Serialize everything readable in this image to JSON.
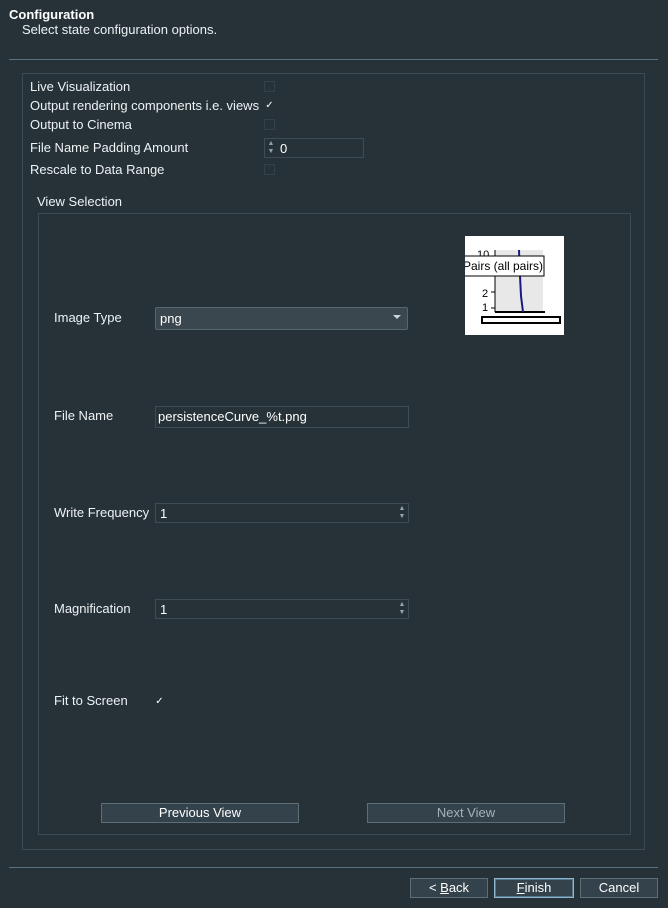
{
  "header": {
    "title": "Configuration",
    "subtitle": "Select state configuration options."
  },
  "options": {
    "live_visualization": {
      "label": "Live Visualization",
      "checked": false
    },
    "output_rendering": {
      "label": "Output rendering components i.e. views",
      "checked": true
    },
    "output_cinema": {
      "label": "Output to Cinema",
      "checked": false
    },
    "padding": {
      "label": "File Name Padding Amount",
      "value": "0"
    },
    "rescale": {
      "label": "Rescale to Data Range",
      "checked": false
    }
  },
  "view_selection": {
    "title": "View Selection",
    "image_type": {
      "label": "Image Type",
      "value": "png"
    },
    "file_name": {
      "label": "File Name",
      "value": "persistenceCurve_%t.png"
    },
    "write_frequency": {
      "label": "Write Frequency",
      "value": "1"
    },
    "magnification": {
      "label": "Magnification",
      "value": "1"
    },
    "fit_to_screen": {
      "label": "Fit to Screen",
      "checked": true
    },
    "previous_view": "Previous View",
    "next_view": "Next View",
    "preview": {
      "legend": "Pairs (all pairs)",
      "tick_top": "10",
      "tick_mid": "2",
      "tick_low": "1"
    }
  },
  "footer": {
    "back_prefix": "< ",
    "back_mnemonic": "B",
    "back_rest": "ack",
    "finish_mnemonic": "F",
    "finish_rest": "inish",
    "cancel": "Cancel"
  },
  "check_glyph": "✓"
}
